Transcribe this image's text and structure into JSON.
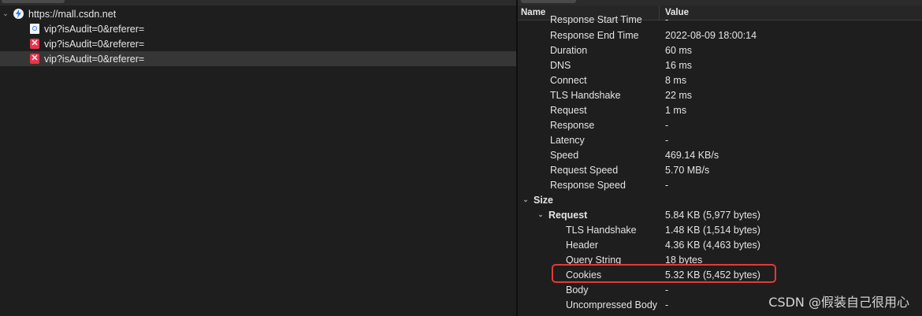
{
  "left_tree": {
    "host": {
      "label": "https://mall.csdn.net",
      "icon": "lightning-icon"
    },
    "requests": [
      {
        "label": "vip?isAudit=0&referer=",
        "status": "ok",
        "icon": "request-file-icon"
      },
      {
        "label": "vip?isAudit=0&referer=",
        "status": "error",
        "icon": "error-icon"
      },
      {
        "label": "vip?isAudit=0&referer=",
        "status": "error",
        "icon": "error-icon",
        "selected": true
      }
    ]
  },
  "details_table": {
    "header": {
      "name": "Name",
      "value": "Value"
    },
    "timing_rows": [
      {
        "name": "Response Start Time",
        "value": "-"
      },
      {
        "name": "Response End Time",
        "value": "2022-08-09 18:00:14"
      },
      {
        "name": "Duration",
        "value": "60 ms"
      },
      {
        "name": "DNS",
        "value": "16 ms"
      },
      {
        "name": "Connect",
        "value": "8 ms"
      },
      {
        "name": "TLS Handshake",
        "value": "22 ms"
      },
      {
        "name": "Request",
        "value": "1 ms"
      },
      {
        "name": "Response",
        "value": "-"
      },
      {
        "name": "Latency",
        "value": "-"
      },
      {
        "name": "Speed",
        "value": "469.14 KB/s"
      },
      {
        "name": "Request Speed",
        "value": "5.70 MB/s"
      },
      {
        "name": "Response Speed",
        "value": "-"
      }
    ],
    "size_group": {
      "name": "Size",
      "value": ""
    },
    "request_group": {
      "name": "Request",
      "value": "5.84 KB (5,977 bytes)"
    },
    "request_rows": [
      {
        "name": "TLS Handshake",
        "value": "1.48 KB (1,514 bytes)"
      },
      {
        "name": "Header",
        "value": "4.36 KB (4,463 bytes)"
      },
      {
        "name": "Query String",
        "value": "18 bytes"
      },
      {
        "name": "Cookies",
        "value": "5.32 KB (5,452 bytes)"
      },
      {
        "name": "Body",
        "value": "-"
      },
      {
        "name": "Uncompressed Body",
        "value": "-"
      }
    ]
  },
  "watermark": "CSDN @假装自己很用心",
  "colors": {
    "highlight": "#e53935",
    "error": "#e8334a",
    "selected_row": "#363636"
  }
}
